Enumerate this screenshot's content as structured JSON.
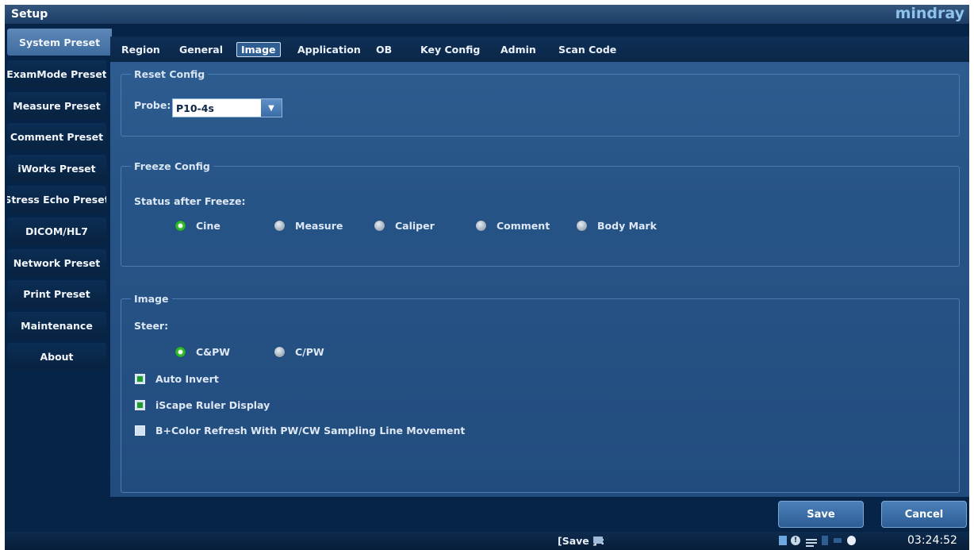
{
  "window": {
    "title": "Setup",
    "brand": "mindray"
  },
  "sidebar": {
    "items": [
      {
        "label": "System Preset",
        "active": true
      },
      {
        "label": "ExamMode Preset"
      },
      {
        "label": "Measure Preset"
      },
      {
        "label": "Comment Preset"
      },
      {
        "label": "iWorks Preset"
      },
      {
        "label": "Stress Echo Preset"
      },
      {
        "label": "DICOM/HL7"
      },
      {
        "label": "Network Preset"
      },
      {
        "label": "Print Preset"
      },
      {
        "label": "Maintenance"
      },
      {
        "label": "About"
      }
    ]
  },
  "tabs": [
    {
      "label": "Region"
    },
    {
      "label": "General"
    },
    {
      "label": "Image",
      "active": true
    },
    {
      "label": "Application"
    },
    {
      "label": "OB"
    },
    {
      "label": "Key Config"
    },
    {
      "label": "Admin"
    },
    {
      "label": "Scan Code"
    }
  ],
  "reset_config": {
    "legend": "Reset Config",
    "probe_label": "Probe:",
    "probe_value": "P10-4s"
  },
  "freeze_config": {
    "legend": "Freeze Config",
    "status_label": "Status after Freeze:",
    "options": [
      {
        "label": "Cine",
        "selected": true
      },
      {
        "label": "Measure"
      },
      {
        "label": "Caliper"
      },
      {
        "label": "Comment"
      },
      {
        "label": "Body Mark"
      }
    ]
  },
  "image_group": {
    "legend": "Image",
    "steer_label": "Steer:",
    "steer_options": [
      {
        "label": "C&PW",
        "selected": true
      },
      {
        "label": "C/PW"
      }
    ],
    "checkboxes": [
      {
        "label": "Auto Invert",
        "checked": true
      },
      {
        "label": "iScape Ruler Display",
        "checked": true
      },
      {
        "label": "B+Color Refresh With PW/CW Sampling Line Movement",
        "checked": false
      }
    ]
  },
  "buttons": {
    "save": "Save",
    "cancel": "Cancel"
  },
  "statusbar": {
    "save_hint": "[Save ] :",
    "clock": "03:24:52"
  },
  "colors": {
    "background": "#062447",
    "panel": "#275487",
    "radio_selected": "#2fb52f",
    "checkbox_checked": "#1e9a2a"
  }
}
